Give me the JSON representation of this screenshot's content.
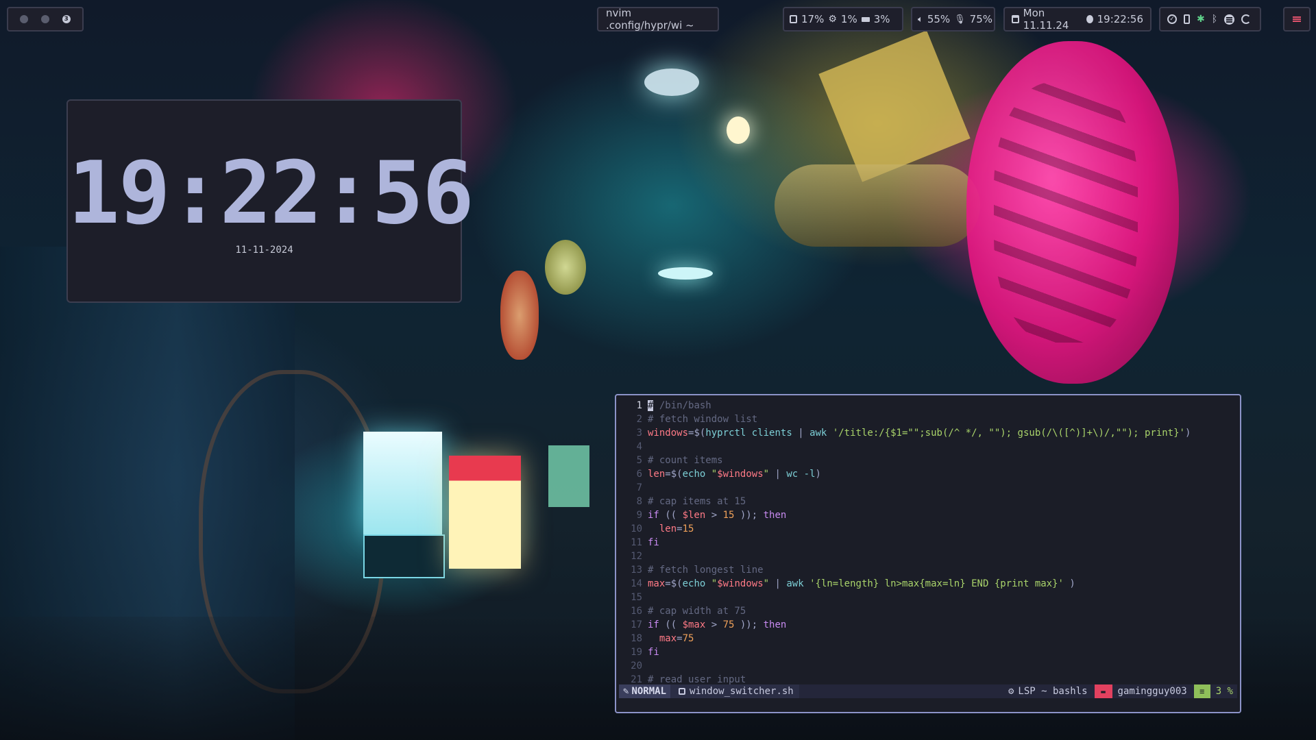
{
  "topbar": {
    "workspaces": [
      "1",
      "2",
      "3"
    ],
    "active_workspace": "3",
    "window_title": "nvim .config/hypr/wi ~",
    "cpu": "17%",
    "memory": "1%",
    "disk": "3%",
    "volume": "55%",
    "mic": "75%",
    "date": "Mon 11.11.24",
    "time": "19:22:56",
    "tray_icons": [
      "check-circle",
      "phone",
      "slack",
      "bluetooth",
      "spotify",
      "sync"
    ],
    "menu_icon": "menu"
  },
  "clock_widget": {
    "time": "19:22:56",
    "date": "11-11-2024"
  },
  "editor": {
    "current_line": 1,
    "lines": [
      {
        "n": "1",
        "segs": [
          [
            "cursor",
            "#"
          ],
          [
            "c-comment",
            " /bin/bash"
          ]
        ]
      },
      {
        "n": "2",
        "segs": [
          [
            "c-comment",
            "# fetch window list"
          ]
        ]
      },
      {
        "n": "3",
        "segs": [
          [
            "c-var",
            "windows"
          ],
          [
            "c-op",
            "=$("
          ],
          [
            "c-cmd",
            "hyprctl"
          ],
          [
            "c-plain",
            " "
          ],
          [
            "c-cmd",
            "clients"
          ],
          [
            "c-op",
            " | "
          ],
          [
            "c-cmd",
            "awk"
          ],
          [
            "c-plain",
            " "
          ],
          [
            "c-str",
            "'/title:/{$1=\"\";sub(/^ */, \"\"); gsub(/\\([^)]+\\)/,\"\"); print}'"
          ],
          [
            "c-op",
            ")"
          ]
        ]
      },
      {
        "n": "4",
        "segs": []
      },
      {
        "n": "5",
        "segs": [
          [
            "c-comment",
            "# count items"
          ]
        ]
      },
      {
        "n": "6",
        "segs": [
          [
            "c-var",
            "len"
          ],
          [
            "c-op",
            "=$("
          ],
          [
            "c-cmd",
            "echo"
          ],
          [
            "c-plain",
            " "
          ],
          [
            "c-str",
            "\""
          ],
          [
            "c-var",
            "$windows"
          ],
          [
            "c-str",
            "\""
          ],
          [
            "c-op",
            " | "
          ],
          [
            "c-cmd",
            "wc"
          ],
          [
            "c-plain",
            " "
          ],
          [
            "c-cmd",
            "-l"
          ],
          [
            "c-op",
            ")"
          ]
        ]
      },
      {
        "n": "7",
        "segs": []
      },
      {
        "n": "8",
        "segs": [
          [
            "c-comment",
            "# cap items at 15"
          ]
        ]
      },
      {
        "n": "9",
        "segs": [
          [
            "c-kw",
            "if"
          ],
          [
            "c-op",
            " (( "
          ],
          [
            "c-var",
            "$len"
          ],
          [
            "c-op",
            " > "
          ],
          [
            "c-num",
            "15"
          ],
          [
            "c-op",
            " )); "
          ],
          [
            "c-kw",
            "then"
          ]
        ]
      },
      {
        "n": "10",
        "segs": [
          [
            "c-plain",
            "  "
          ],
          [
            "c-var",
            "len"
          ],
          [
            "c-op",
            "="
          ],
          [
            "c-num",
            "15"
          ]
        ]
      },
      {
        "n": "11",
        "segs": [
          [
            "c-kw",
            "fi"
          ]
        ]
      },
      {
        "n": "12",
        "segs": []
      },
      {
        "n": "13",
        "segs": [
          [
            "c-comment",
            "# fetch longest line"
          ]
        ]
      },
      {
        "n": "14",
        "segs": [
          [
            "c-var",
            "max"
          ],
          [
            "c-op",
            "=$("
          ],
          [
            "c-cmd",
            "echo"
          ],
          [
            "c-plain",
            " "
          ],
          [
            "c-str",
            "\""
          ],
          [
            "c-var",
            "$windows"
          ],
          [
            "c-str",
            "\""
          ],
          [
            "c-op",
            " | "
          ],
          [
            "c-cmd",
            "awk"
          ],
          [
            "c-plain",
            " "
          ],
          [
            "c-str",
            "'{ln=length} ln>max{max=ln} END {print max}'"
          ],
          [
            "c-op",
            " )"
          ]
        ]
      },
      {
        "n": "15",
        "segs": []
      },
      {
        "n": "16",
        "segs": [
          [
            "c-comment",
            "# cap width at 75"
          ]
        ]
      },
      {
        "n": "17",
        "segs": [
          [
            "c-kw",
            "if"
          ],
          [
            "c-op",
            " (( "
          ],
          [
            "c-var",
            "$max"
          ],
          [
            "c-op",
            " > "
          ],
          [
            "c-num",
            "75"
          ],
          [
            "c-op",
            " )); "
          ],
          [
            "c-kw",
            "then"
          ]
        ]
      },
      {
        "n": "18",
        "segs": [
          [
            "c-plain",
            "  "
          ],
          [
            "c-var",
            "max"
          ],
          [
            "c-op",
            "="
          ],
          [
            "c-num",
            "75"
          ]
        ]
      },
      {
        "n": "19",
        "segs": [
          [
            "c-kw",
            "fi"
          ]
        ]
      },
      {
        "n": "20",
        "segs": []
      },
      {
        "n": "21",
        "segs": [
          [
            "c-comment",
            "# read user input"
          ]
        ]
      }
    ],
    "statusline": {
      "mode": "NORMAL",
      "filename": "window_switcher.sh",
      "lsp": "LSP ~ bashls",
      "user": "gamingguy003",
      "percent": "3 %"
    }
  },
  "colors": {
    "bar_bg": "#1e1f2b",
    "clock_digits": "#aeb5db",
    "editor_border": "#8c93c8",
    "accent_red": "#e2415f",
    "accent_green": "#8fbf5a"
  }
}
